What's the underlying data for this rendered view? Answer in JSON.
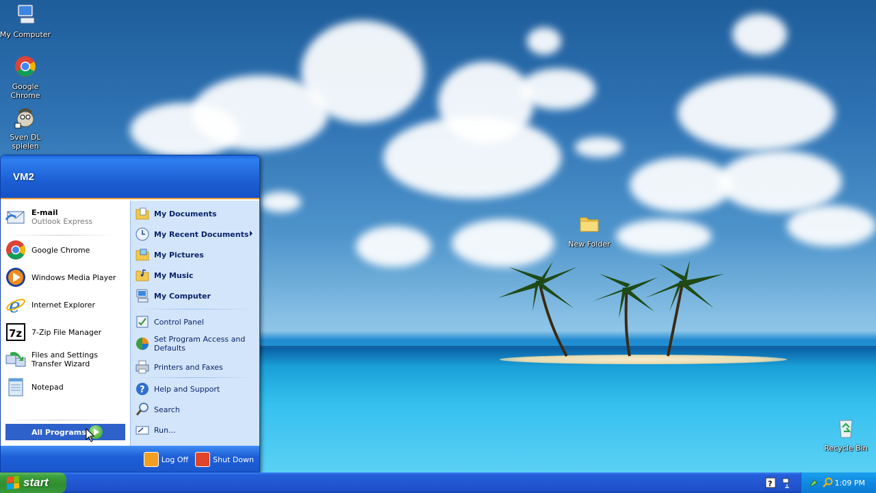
{
  "desktop": {
    "icons": [
      {
        "label": "My Computer",
        "icon": "my-computer-icon"
      },
      {
        "label": "Google Chrome",
        "icon": "chrome-icon"
      },
      {
        "label": "Sven DL spielen",
        "icon": "sven-icon"
      },
      {
        "label": "New Folder",
        "icon": "folder-icon"
      },
      {
        "label": "Recycle Bin",
        "icon": "recycle-bin-icon"
      }
    ]
  },
  "start_menu": {
    "user": "VM2",
    "pinned": [
      {
        "label": "E-mail",
        "sub": "Outlook Express",
        "icon": "email-icon"
      }
    ],
    "recent": [
      {
        "label": "Google Chrome",
        "icon": "chrome-icon"
      },
      {
        "label": "Windows Media Player",
        "icon": "media-player-icon"
      },
      {
        "label": "Internet Explorer",
        "icon": "ie-icon"
      },
      {
        "label": "7-Zip File Manager",
        "icon": "7zip-icon"
      },
      {
        "label": "Files and Settings Transfer Wizard",
        "icon": "transfer-wizard-icon"
      },
      {
        "label": "Notepad",
        "icon": "notepad-icon"
      }
    ],
    "all_programs": "All Programs",
    "places": [
      {
        "label": "My Documents",
        "icon": "folder-docs-icon"
      },
      {
        "label": "My Recent Documents",
        "icon": "recent-docs-icon"
      },
      {
        "label": "My Pictures",
        "icon": "folder-pictures-icon"
      },
      {
        "label": "My Music",
        "icon": "folder-music-icon"
      },
      {
        "label": "My Computer",
        "icon": "my-computer-icon"
      }
    ],
    "settings": [
      {
        "label": "Control Panel",
        "icon": "control-panel-icon"
      },
      {
        "label": "Set Program Access and Defaults",
        "icon": "program-access-icon"
      },
      {
        "label": "Printers and Faxes",
        "icon": "printer-icon"
      }
    ],
    "help": [
      {
        "label": "Help and Support",
        "icon": "help-icon"
      },
      {
        "label": "Search",
        "icon": "search-icon"
      },
      {
        "label": "Run...",
        "icon": "run-icon"
      }
    ],
    "footer": {
      "log_off": "Log Off",
      "shut_down": "Shut Down"
    }
  },
  "taskbar": {
    "start_label": "start",
    "clock": "1:09 PM"
  },
  "colors": {
    "taskbar_blue": "#245edb",
    "start_green": "#3c9e3c",
    "menu_header_blue": "#1c5fd3",
    "right_pane": "#d3e5fa",
    "accent_orange": "#f19d38"
  }
}
